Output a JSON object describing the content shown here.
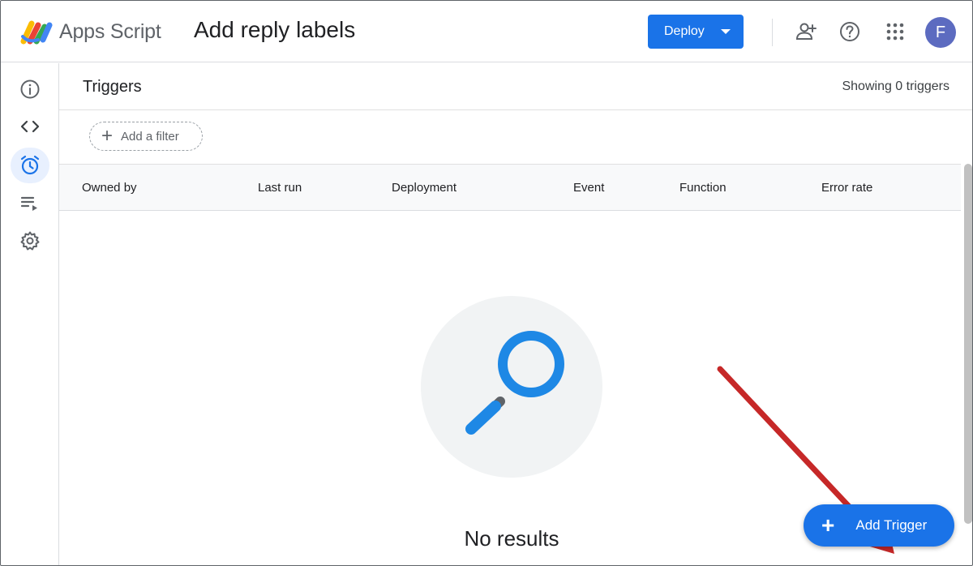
{
  "header": {
    "app_name": "Apps Script",
    "project_title": "Add reply labels",
    "deploy_label": "Deploy",
    "avatar_initial": "F"
  },
  "nav": {
    "items": [
      {
        "name": "overview",
        "icon": "info-icon"
      },
      {
        "name": "editor",
        "icon": "code-icon"
      },
      {
        "name": "triggers",
        "icon": "alarm-icon",
        "active": true
      },
      {
        "name": "executions",
        "icon": "executions-icon"
      },
      {
        "name": "settings",
        "icon": "gear-icon"
      }
    ]
  },
  "triggers": {
    "title": "Triggers",
    "showing": "Showing 0 triggers",
    "filter_label": "Add a filter",
    "columns": [
      "Owned by",
      "Last run",
      "Deployment",
      "Event",
      "Function",
      "Error rate"
    ],
    "empty_text": "No results",
    "add_trigger_label": "Add Trigger"
  },
  "colors": {
    "accent": "#1a73e8",
    "avatar": "#5c6bc0",
    "annotation_arrow": "#c62828"
  }
}
